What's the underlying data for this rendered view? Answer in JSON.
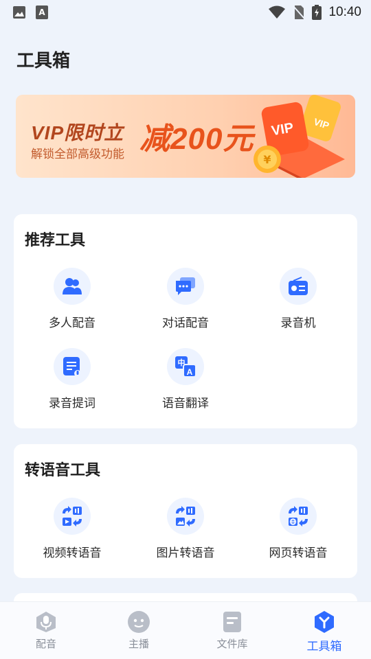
{
  "status_bar": {
    "time": "10:40",
    "icons": [
      "image-icon",
      "font-a-icon",
      "wifi-icon",
      "no-sim-icon",
      "battery-charging-icon"
    ]
  },
  "page": {
    "title": "工具箱"
  },
  "banner": {
    "line1": "VIP限时立",
    "promo": "减200元",
    "line2": "解锁全部高级功能",
    "art_text": "VIP",
    "coin_symbol": "¥"
  },
  "recommended": {
    "title": "推荐工具",
    "tools": [
      {
        "label": "多人配音",
        "icon": "people-icon"
      },
      {
        "label": "对话配音",
        "icon": "chat-icon"
      },
      {
        "label": "录音机",
        "icon": "radio-icon"
      },
      {
        "label": "录音提词",
        "icon": "script-mic-icon"
      },
      {
        "label": "语音翻译",
        "icon": "translate-icon"
      }
    ]
  },
  "tts": {
    "title": "转语音工具",
    "tools": [
      {
        "label": "视频转语音",
        "icon": "video-to-audio-icon"
      },
      {
        "label": "图片转语音",
        "icon": "image-to-audio-icon"
      },
      {
        "label": "网页转语音",
        "icon": "web-to-audio-icon"
      }
    ]
  },
  "tabbar": {
    "active": "工具箱",
    "tabs": [
      {
        "label": "配音",
        "icon": "mic-icon"
      },
      {
        "label": "主播",
        "icon": "face-icon"
      },
      {
        "label": "文件库",
        "icon": "folder-icon"
      },
      {
        "label": "工具箱",
        "icon": "toolbox-icon"
      }
    ]
  },
  "colors": {
    "accent": "#2f6bff",
    "icon_bg": "#edf3ff",
    "banner_orange": "#e8531c",
    "page_bg": "#eef3fb"
  }
}
